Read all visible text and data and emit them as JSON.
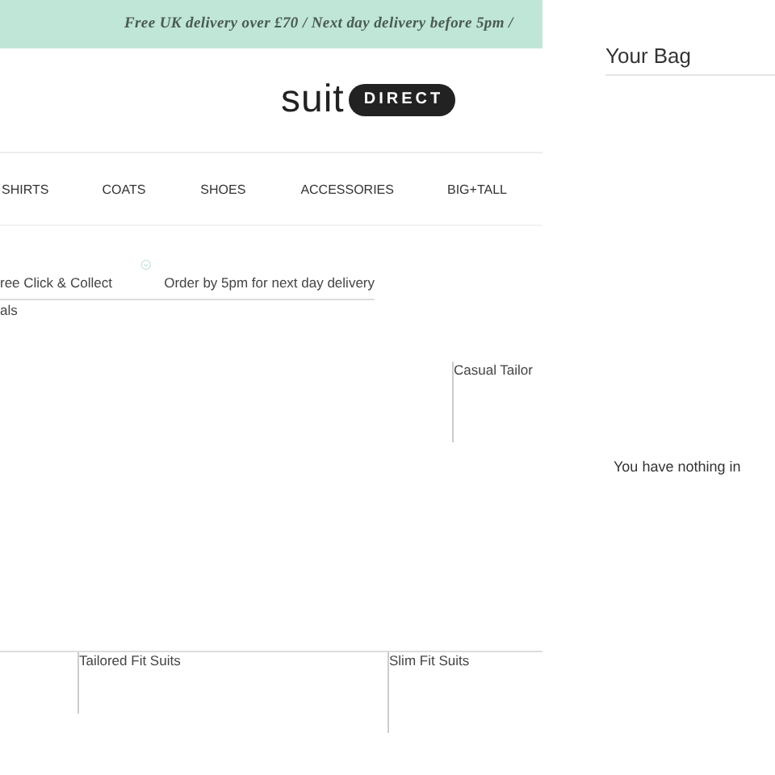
{
  "banner": {
    "text": "Free UK delivery over £70 / Next day delivery before 5pm /"
  },
  "logo": {
    "word": "suit",
    "badge": "DIRECT"
  },
  "nav": [
    {
      "label": "SHIRTS"
    },
    {
      "label": "COATS"
    },
    {
      "label": "SHOES"
    },
    {
      "label": "ACCESSORIES"
    },
    {
      "label": "BIG+TALL"
    }
  ],
  "delivery": {
    "left": "ree Click & Collect",
    "right": "Order by 5pm for next day delivery"
  },
  "section_label": "als",
  "featured_tiles": [
    {
      "label": "Casual Tailor"
    }
  ],
  "category_tiles": [
    {
      "label": "Tailored Fit Suits"
    },
    {
      "label": "Slim Fit Suits"
    }
  ],
  "bag": {
    "title": "Your Bag",
    "message": "You have nothing in"
  }
}
